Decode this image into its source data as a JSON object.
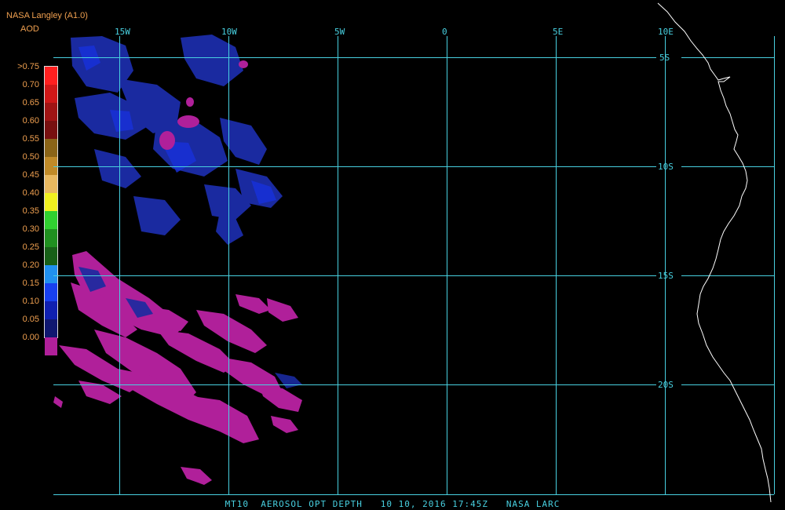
{
  "header": {
    "source": "NASA Langley (A1.0)",
    "product": "AOD"
  },
  "colorbar": {
    "levels": [
      {
        "label": ">0.75",
        "color": "#ff2020"
      },
      {
        "label": "0.70",
        "color": "#d01818"
      },
      {
        "label": "0.65",
        "color": "#a01414"
      },
      {
        "label": "0.60",
        "color": "#781010"
      },
      {
        "label": "0.55",
        "color": "#8a6418"
      },
      {
        "label": "0.50",
        "color": "#c08a28"
      },
      {
        "label": "0.45",
        "color": "#e8b860"
      },
      {
        "label": "0.40",
        "color": "#f0f020"
      },
      {
        "label": "0.35",
        "color": "#30d030"
      },
      {
        "label": "0.30",
        "color": "#209020"
      },
      {
        "label": "0.25",
        "color": "#186018"
      },
      {
        "label": "0.20",
        "color": "#2090f0"
      },
      {
        "label": "0.15",
        "color": "#1840f0"
      },
      {
        "label": "0.10",
        "color": "#1020b0"
      },
      {
        "label": "0.05",
        "color": "#101870"
      },
      {
        "label": "0.00",
        "color": "#b0209a"
      }
    ]
  },
  "map": {
    "grid_color": "#48d0e0",
    "coast_color": "#ffffff",
    "longitude_labels": [
      "15W",
      "10W",
      "5W",
      "0",
      "5E",
      "10E"
    ],
    "latitude_labels": [
      "5S",
      "10S",
      "15S",
      "20S"
    ]
  },
  "footer": {
    "caption": "MT10  AEROSOL OPT DEPTH   10 10, 2016 17:45Z   NASA LARC"
  }
}
